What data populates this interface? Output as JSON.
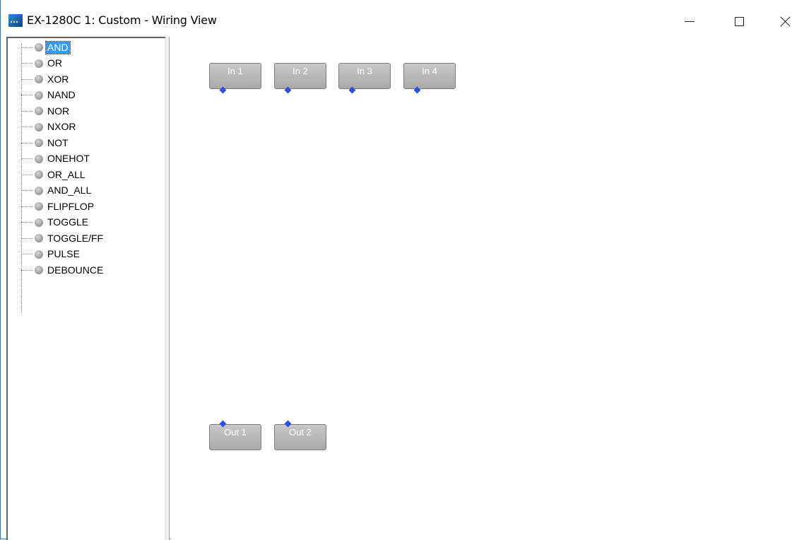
{
  "window": {
    "title": "EX-1280C 1: Custom - Wiring View",
    "controls": {
      "minimize": "minimize",
      "maximize": "maximize",
      "close": "close"
    }
  },
  "tree": {
    "selected": "AND",
    "items": [
      "AND",
      "OR",
      "XOR",
      "NAND",
      "NOR",
      "NXOR",
      "NOT",
      "ONEHOT",
      "OR_ALL",
      "AND_ALL",
      "FLIPFLOP",
      "TOGGLE",
      "TOGGLE/FF",
      "PULSE",
      "DEBOUNCE"
    ]
  },
  "canvas": {
    "inputs": [
      "In 1",
      "In 2",
      "In 3",
      "In 4"
    ],
    "outputs": [
      "Out 1",
      "Out 2"
    ]
  },
  "colors": {
    "selection": "#3399ff",
    "pin": "#2b4fe0",
    "node_fill": "#b8b8b8"
  },
  "icons": {
    "app": "app-icon",
    "tree_bullet": "gray-circle-icon",
    "pin": "diamond-pin-icon"
  }
}
